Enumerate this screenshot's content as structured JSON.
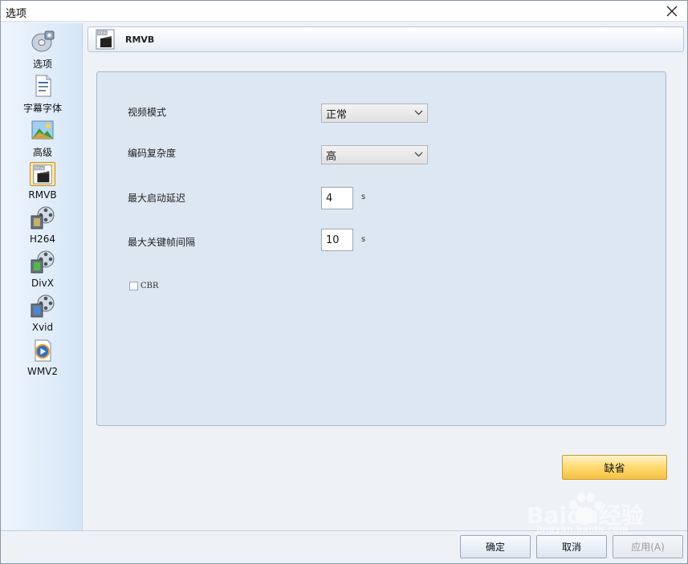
{
  "window": {
    "title": "选项"
  },
  "sidebar": {
    "items": [
      {
        "label": "选项",
        "icon": "options-disc-icon"
      },
      {
        "label": "字幕字体",
        "icon": "subtitle-document-icon"
      },
      {
        "label": "高级",
        "icon": "landscape-picture-icon"
      },
      {
        "label": "RMVB",
        "icon": "real-clapperboard-icon",
        "active": true
      },
      {
        "label": "H264",
        "icon": "film-reel-icon"
      },
      {
        "label": "DivX",
        "icon": "film-reel-green-icon"
      },
      {
        "label": "Xvid",
        "icon": "film-reel-blue-icon"
      },
      {
        "label": "WMV2",
        "icon": "media-disc-play-icon"
      }
    ]
  },
  "header": {
    "title": "RMVB",
    "icon_badge": "REAL"
  },
  "form": {
    "video_mode": {
      "label": "视频模式",
      "value": "正常"
    },
    "encode_complexity": {
      "label": "编码复杂度",
      "value": "高"
    },
    "max_start_delay": {
      "label": "最大启动延迟",
      "value": "4",
      "unit": "s"
    },
    "max_keyframe_interval": {
      "label": "最大关键帧间隔",
      "value": "10",
      "unit": "s"
    },
    "cbr": {
      "label": "CBR",
      "checked": false
    }
  },
  "buttons": {
    "default_label": "缺省",
    "ok_label": "确定",
    "cancel_label": "取消",
    "apply_label": "应用(A)"
  },
  "watermark": {
    "text": "Baidu经验",
    "url": "jingyan.baidu.com"
  },
  "colors": {
    "accent": "#ffd76a",
    "sidebar": "#dbe8f7",
    "panel": "#dde7f2"
  }
}
